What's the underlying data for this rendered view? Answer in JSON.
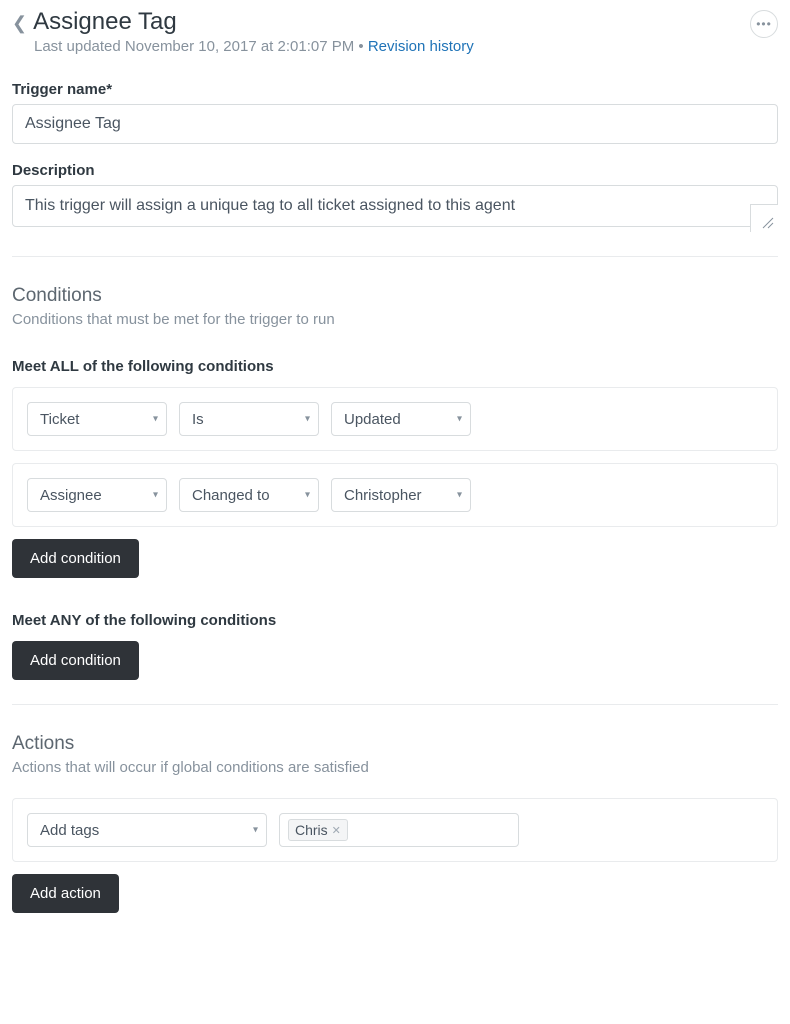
{
  "header": {
    "title": "Assignee Tag",
    "last_updated_prefix": "Last updated ",
    "last_updated": "November 10, 2017 at 2:01:07 PM",
    "revision_link": "Revision history"
  },
  "fields": {
    "trigger_name_label": "Trigger name*",
    "trigger_name_value": "Assignee Tag",
    "description_label": "Description",
    "description_value": "This trigger will assign a unique tag to all ticket assigned to this agent"
  },
  "conditions": {
    "title": "Conditions",
    "subtitle": "Conditions that must be met for the trigger to run",
    "all_heading": "Meet ALL of the following conditions",
    "any_heading": "Meet ANY of the following conditions",
    "add_condition_label": "Add condition",
    "all_rows": [
      {
        "field": "Ticket",
        "operator": "Is",
        "value": "Updated"
      },
      {
        "field": "Assignee",
        "operator": "Changed to",
        "value": "Christopher"
      }
    ]
  },
  "actions": {
    "title": "Actions",
    "subtitle": "Actions that will occur if global conditions are satisfied",
    "add_action_label": "Add action",
    "rows": [
      {
        "field": "Add tags",
        "tags": [
          "Chris"
        ]
      }
    ]
  }
}
